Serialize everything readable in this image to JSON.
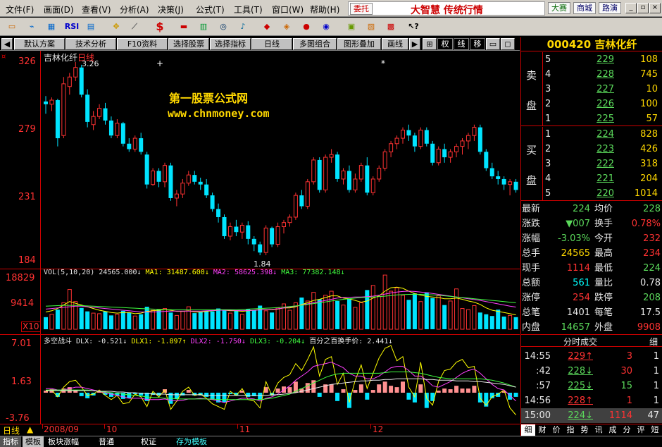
{
  "menu": [
    "文件(F)",
    "画面(D)",
    "查看(V)",
    "分析(A)",
    "决策(J)",
    "公式(T)",
    "工具(T)",
    "窗口(W)",
    "帮助(H)"
  ],
  "brand": {
    "order_btn": "委托",
    "logo": "大智慧 传统行情",
    "btn1": "大赛",
    "btn2": "商城",
    "btn3": "路演"
  },
  "toolbar": {
    "rsi": "RSI",
    "dollar": "$"
  },
  "tabs": [
    "默认方案",
    "技术分析",
    "F10资料",
    "选择股票",
    "选择指标",
    "日线",
    "多图组合",
    "图形叠加",
    "画线"
  ],
  "tabs_right": [
    "权",
    "线",
    "移"
  ],
  "chart": {
    "stock_label": "吉林化纤",
    "period_label": "日线",
    "price_ticks": [
      "326",
      "279",
      "231",
      "184"
    ],
    "high_mark": "3.26",
    "low_mark": "1.84",
    "watermark1": "第一股票公式网",
    "watermark2": "www.chnmoney.com",
    "vol_ticks": [
      "18829",
      "9414",
      "X10"
    ],
    "vol_legend": {
      "name": "VOL(5,10,20)",
      "val": "24565.000↓",
      "ma1": "MA1: 31487.600↓",
      "ma2": "MA2: 58625.398↓",
      "ma3": "MA3: 77382.148↓"
    },
    "ind_ticks": [
      "7.01",
      "1.63",
      "-3.76"
    ],
    "ind_legend": {
      "name": "多空战斗",
      "dlx": "DLX: -0.521↓",
      "dlx1": "DLX1: -1.897↑",
      "dlx2": "DLX2: -1.750↓",
      "dlx3": "DLX3: -0.204↓",
      "pct": "百分之百换手价: 2.441↓"
    },
    "date_labels": [
      "2008/09",
      "10",
      "11",
      "12"
    ],
    "candles": [
      [
        2.97,
        3.01,
        2.88,
        2.95
      ],
      [
        2.95,
        3.0,
        2.9,
        2.98
      ],
      [
        2.98,
        2.99,
        2.64,
        2.7
      ],
      [
        2.72,
        3.15,
        2.7,
        3.1
      ],
      [
        3.08,
        3.18,
        3.02,
        3.15
      ],
      [
        3.15,
        3.26,
        3.12,
        3.22
      ],
      [
        3.22,
        3.24,
        3.0,
        3.02
      ],
      [
        3.02,
        3.06,
        2.78,
        2.82
      ],
      [
        2.8,
        2.9,
        2.76,
        2.86
      ],
      [
        2.86,
        2.95,
        2.84,
        2.92
      ],
      [
        2.92,
        2.96,
        2.8,
        2.83
      ],
      [
        2.83,
        2.86,
        2.7,
        2.72
      ],
      [
        2.72,
        2.84,
        2.7,
        2.81
      ],
      [
        2.81,
        2.82,
        2.64,
        2.66
      ],
      [
        2.66,
        2.7,
        2.6,
        2.62
      ],
      [
        2.62,
        2.72,
        2.6,
        2.7
      ],
      [
        2.7,
        2.74,
        2.58,
        2.6
      ],
      [
        2.58,
        2.6,
        2.33,
        2.36
      ],
      [
        2.36,
        2.48,
        2.35,
        2.46
      ],
      [
        2.46,
        2.48,
        2.34,
        2.38
      ],
      [
        2.38,
        2.52,
        2.34,
        2.5
      ],
      [
        2.5,
        2.52,
        2.24,
        2.26
      ],
      [
        2.26,
        2.32,
        2.2,
        2.29
      ],
      [
        2.29,
        2.4,
        2.26,
        2.37
      ],
      [
        2.37,
        2.46,
        2.35,
        2.43
      ],
      [
        2.43,
        2.46,
        2.36,
        2.38
      ],
      [
        2.38,
        2.41,
        2.32,
        2.36
      ],
      [
        2.36,
        2.4,
        2.26,
        2.28
      ],
      [
        2.28,
        2.3,
        2.16,
        2.18
      ],
      [
        2.18,
        2.22,
        2.08,
        2.12
      ],
      [
        2.12,
        2.14,
        1.96,
        1.98
      ],
      [
        1.98,
        2.08,
        1.95,
        2.05
      ],
      [
        2.05,
        2.1,
        1.98,
        2.01
      ],
      [
        2.01,
        2.08,
        1.96,
        2.06
      ],
      [
        2.06,
        2.09,
        1.92,
        1.96
      ],
      [
        1.96,
        1.98,
        1.87,
        1.92
      ],
      [
        1.92,
        1.94,
        1.84,
        1.86
      ],
      [
        1.86,
        2.06,
        1.84,
        2.04
      ],
      [
        2.04,
        2.05,
        1.9,
        1.92
      ],
      [
        1.92,
        2.08,
        1.9,
        2.05
      ],
      [
        2.05,
        2.1,
        2.0,
        2.08
      ],
      [
        2.08,
        2.14,
        2.05,
        2.12
      ],
      [
        2.12,
        2.3,
        2.1,
        2.28
      ],
      [
        2.28,
        2.32,
        2.18,
        2.2
      ],
      [
        2.2,
        2.4,
        2.18,
        2.38
      ],
      [
        2.38,
        2.56,
        2.36,
        2.54
      ],
      [
        2.54,
        2.56,
        2.3,
        2.32
      ],
      [
        2.32,
        2.58,
        2.3,
        2.56
      ],
      [
        2.56,
        2.62,
        2.52,
        2.58
      ],
      [
        2.58,
        2.6,
        2.38,
        2.4
      ],
      [
        2.4,
        2.48,
        2.36,
        2.46
      ],
      [
        2.46,
        2.5,
        2.3,
        2.32
      ],
      [
        2.32,
        2.44,
        2.3,
        2.4
      ],
      [
        2.4,
        2.52,
        2.38,
        2.5
      ],
      [
        2.5,
        2.56,
        2.28,
        2.3
      ],
      [
        2.3,
        2.42,
        2.28,
        2.4
      ],
      [
        2.4,
        2.5,
        2.38,
        2.48
      ],
      [
        2.48,
        2.62,
        2.46,
        2.6
      ],
      [
        2.6,
        2.68,
        2.56,
        2.66
      ],
      [
        2.66,
        2.72,
        2.62,
        2.7
      ],
      [
        2.7,
        2.78,
        2.66,
        2.76
      ],
      [
        2.76,
        2.8,
        2.68,
        2.72
      ],
      [
        2.72,
        2.74,
        2.6,
        2.64
      ],
      [
        2.64,
        2.78,
        2.62,
        2.76
      ],
      [
        2.76,
        2.78,
        2.64,
        2.66
      ],
      [
        2.66,
        2.68,
        2.5,
        2.52
      ],
      [
        2.52,
        2.64,
        2.5,
        2.62
      ],
      [
        2.62,
        2.66,
        2.52,
        2.56
      ],
      [
        2.56,
        2.62,
        2.52,
        2.6
      ],
      [
        2.6,
        2.66,
        2.56,
        2.64
      ],
      [
        2.64,
        2.7,
        2.58,
        2.68
      ],
      [
        2.68,
        2.74,
        2.62,
        2.72
      ],
      [
        2.72,
        2.8,
        2.68,
        2.78
      ],
      [
        2.78,
        2.8,
        2.58,
        2.6
      ],
      [
        2.6,
        2.62,
        2.46,
        2.48
      ],
      [
        2.48,
        2.52,
        2.4,
        2.42
      ],
      [
        2.42,
        2.46,
        2.36,
        2.4
      ],
      [
        2.4,
        2.42,
        2.32,
        2.36
      ],
      [
        2.36,
        2.4,
        2.28,
        2.38
      ],
      [
        2.38,
        2.4,
        2.3,
        2.32
      ],
      [
        2.32,
        2.34,
        2.26,
        2.28
      ]
    ],
    "volumes": [
      4200,
      5200,
      6800,
      9200,
      13800,
      9600,
      7400,
      6200,
      5600,
      5400,
      6200,
      4800,
      5200,
      6400,
      5800,
      4600,
      5200,
      7800,
      6600,
      6800,
      7200,
      5800,
      4800,
      6200,
      7800,
      5600,
      6000,
      6400,
      6200,
      7200,
      6800,
      5600,
      6400,
      5200,
      7000,
      6600,
      8200,
      6400,
      5800,
      7400,
      8800,
      6600,
      9200,
      11000,
      9800,
      12800,
      10400,
      11800,
      13200,
      9800,
      8400,
      10600,
      7600,
      9200,
      13600,
      15200,
      11400,
      18800,
      13200,
      14400,
      11800,
      10200,
      12400,
      9600,
      12800,
      10800,
      11600,
      8400,
      9800,
      14000,
      7200,
      6800,
      8200,
      5800,
      5200,
      4600,
      6800,
      4400,
      4800,
      4200
    ],
    "ma_vol": {
      "ma1": [
        6000,
        6400,
        7200,
        8400,
        9600,
        9000,
        8400,
        7800,
        7200,
        6600,
        6200,
        5800,
        5600,
        5800,
        5800,
        5400,
        5600,
        6200,
        6400,
        6600,
        6800,
        6600,
        6200,
        6200,
        6400,
        6000,
        6000,
        6200,
        6400,
        6600,
        6600,
        6400,
        6400,
        6200,
        6400,
        6600,
        6800,
        6800,
        6800,
        7000,
        7400,
        7400,
        7800,
        8600,
        9200,
        10000,
        10400,
        11000,
        11600,
        11600,
        10800,
        10600,
        10000,
        9400,
        9800,
        10800,
        11600,
        13200,
        14400,
        14600,
        14200,
        13200,
        12400,
        11800,
        11400,
        11200,
        11000,
        10600,
        10600,
        10800,
        10400,
        9800,
        9400,
        8600,
        7400,
        6600,
        6200,
        5800,
        5400,
        5000
      ],
      "ma2": [
        7000,
        7200,
        7400,
        7600,
        7800,
        8000,
        8000,
        7800,
        7600,
        7400,
        7200,
        7000,
        6800,
        6600,
        6400,
        6200,
        6000,
        6000,
        6000,
        6100,
        6200,
        6300,
        6300,
        6300,
        6300,
        6300,
        6300,
        6400,
        6500,
        6600,
        6600,
        6600,
        6500,
        6500,
        6500,
        6600,
        6700,
        6800,
        6900,
        7100,
        7400,
        7700,
        8000,
        8400,
        8800,
        9200,
        9600,
        10000,
        10400,
        10800,
        11000,
        11100,
        11200,
        11200,
        11300,
        11500,
        11800,
        12200,
        12600,
        12900,
        13100,
        13200,
        13100,
        12900,
        12700,
        12400,
        12100,
        11800,
        11500,
        11200,
        10900,
        10600,
        10300,
        10000,
        9600,
        9200,
        8800,
        8400,
        8000,
        7700
      ],
      "ma3": [
        8000,
        8100,
        8200,
        8300,
        8300,
        8300,
        8200,
        8100,
        8000,
        7900,
        7800,
        7700,
        7600,
        7500,
        7400,
        7300,
        7200,
        7100,
        7000,
        6900,
        6800,
        6800,
        6800,
        6800,
        6800,
        6800,
        6800,
        6800,
        6800,
        6800,
        6800,
        6800,
        6800,
        6900,
        7000,
        7100,
        7200,
        7300,
        7400,
        7500,
        7700,
        7900,
        8100,
        8300,
        8600,
        8900,
        9200,
        9500,
        9800,
        10100,
        10400,
        10600,
        10800,
        11000,
        11100,
        11200,
        11300,
        11500,
        11700,
        11900,
        12000,
        12100,
        12100,
        12100,
        12000,
        11900,
        11800,
        11600,
        11400,
        11200,
        11000,
        10800,
        10600,
        10400,
        10200,
        10000,
        9800,
        9600,
        9400,
        9200
      ]
    },
    "indicator": {
      "bars": [
        0.3,
        0.5,
        -0.6,
        0.6,
        0.8,
        0.4,
        -0.5,
        -0.8,
        -0.4,
        0.2,
        -0.3,
        -0.6,
        -0.4,
        -0.9,
        -0.8,
        -0.2,
        -0.4,
        -1.2,
        -0.3,
        -0.4,
        0.5,
        -1.6,
        -0.9,
        -0.4,
        0.4,
        -0.4,
        -0.4,
        -0.6,
        -1.0,
        -1.4,
        -1.4,
        -0.2,
        -0.4,
        0.3,
        -0.6,
        -0.5,
        -1.0,
        0.8,
        -0.4,
        0.6,
        0.9,
        0.8,
        1.6,
        0.6,
        1.4,
        1.8,
        -0.6,
        1.2,
        1.2,
        -1.2,
        0.5,
        -2.2,
        0.4,
        1.2,
        -1.0,
        0.4,
        1.2,
        1.6,
        1.0,
        0.8,
        1.6,
        -1.0,
        -1.4,
        1.2,
        -2.2,
        -1.2,
        0.3,
        0.6,
        0.5,
        1.0,
        0.6,
        0.6,
        1.0,
        -1.4,
        -2.0,
        -0.8,
        -0.6,
        0.2,
        -1.0,
        -0.6
      ],
      "dlx": [
        0.2,
        0.4,
        -0.6,
        0.8,
        1.6,
        1.8,
        0.8,
        -0.4,
        -0.2,
        0.4,
        -0.4,
        -1.0,
        -0.4,
        -1.6,
        -1.4,
        -0.2,
        -0.6,
        -2.0,
        0.2,
        -0.6,
        0.4,
        -2.4,
        -1.2,
        0.2,
        0.8,
        -0.4,
        -0.2,
        -0.8,
        -1.6,
        -2.0,
        -2.4,
        0.2,
        -0.4,
        0.6,
        -1.0,
        -1.2,
        -2.2,
        1.6,
        -0.4,
        1.4,
        2.2,
        2.6,
        4.2,
        3.2,
        4.8,
        6.6,
        2.4,
        4.8,
        5.2,
        1.2,
        2.8,
        -1.4,
        1.8,
        4.0,
        0.6,
        2.8,
        5.0,
        6.4,
        6.8,
        4.6,
        5.2,
        0.8,
        -0.6,
        4.4,
        -0.8,
        -1.8,
        1.6,
        3.2,
        3.4,
        4.4,
        4.8,
        3.6,
        3.8,
        -0.8,
        -1.8,
        -0.6,
        -0.2,
        0.4,
        -2.2,
        -3.2
      ],
      "dlx1": [
        0.6,
        0.6,
        0.4,
        0.4,
        0.6,
        0.8,
        0.8,
        0.6,
        0.4,
        0.2,
        0.0,
        -0.2,
        -0.4,
        -0.6,
        -0.8,
        -0.8,
        -0.8,
        -1.0,
        -1.0,
        -1.0,
        -0.9,
        -1.1,
        -1.2,
        -1.1,
        -0.9,
        -0.9,
        -0.8,
        -0.9,
        -1.0,
        -1.2,
        -1.4,
        -1.2,
        -1.0,
        -0.8,
        -0.8,
        -0.9,
        -1.2,
        -0.8,
        -0.6,
        -0.2,
        0.4,
        1.0,
        1.8,
        2.4,
        3.0,
        3.8,
        4.0,
        4.2,
        4.4,
        4.0,
        3.6,
        2.8,
        2.4,
        2.4,
        2.0,
        2.0,
        2.4,
        3.0,
        3.6,
        3.8,
        3.8,
        3.2,
        2.4,
        2.4,
        1.8,
        1.0,
        0.8,
        1.2,
        1.6,
        2.2,
        2.8,
        3.2,
        3.4,
        2.8,
        2.0,
        1.2,
        0.6,
        0.4,
        -0.4,
        -1.2
      ],
      "dlx2": [
        0.4,
        0.4,
        0.4,
        0.4,
        0.4,
        0.4,
        0.4,
        0.4,
        0.3,
        0.2,
        0.1,
        0.0,
        -0.1,
        -0.2,
        -0.3,
        -0.4,
        -0.5,
        -0.6,
        -0.7,
        -0.7,
        -0.8,
        -0.8,
        -0.9,
        -0.9,
        -0.9,
        -0.9,
        -0.9,
        -0.9,
        -0.9,
        -1.0,
        -1.0,
        -1.0,
        -1.0,
        -1.0,
        -1.0,
        -1.0,
        -1.0,
        -0.9,
        -0.8,
        -0.6,
        -0.4,
        -0.2,
        0.2,
        0.6,
        1.0,
        1.4,
        1.8,
        2.2,
        2.5,
        2.7,
        2.8,
        2.8,
        2.8,
        2.8,
        2.8,
        2.8,
        2.8,
        2.9,
        3.0,
        3.0,
        3.0,
        3.0,
        2.9,
        2.8,
        2.6,
        2.4,
        2.2,
        2.1,
        2.0,
        2.0,
        2.0,
        2.0,
        2.0,
        2.0,
        1.9,
        1.8,
        1.6,
        1.4,
        1.1,
        0.8
      ],
      "dlx3": [
        0.3,
        0.3,
        0.3,
        0.3,
        0.3,
        0.3,
        0.3,
        0.3,
        0.3,
        0.2,
        0.2,
        0.2,
        0.1,
        0.1,
        0.0,
        0.0,
        -0.1,
        -0.1,
        -0.2,
        -0.2,
        -0.2,
        -0.3,
        -0.3,
        -0.3,
        -0.3,
        -0.3,
        -0.3,
        -0.4,
        -0.4,
        -0.4,
        -0.4,
        -0.4,
        -0.4,
        -0.4,
        -0.4,
        -0.4,
        -0.4,
        -0.4,
        -0.3,
        -0.3,
        -0.2,
        -0.1,
        0.0,
        0.2,
        0.4,
        0.6,
        0.8,
        1.0,
        1.2,
        1.3,
        1.4,
        1.5,
        1.6,
        1.7,
        1.7,
        1.8,
        1.8,
        1.9,
        1.9,
        2.0,
        2.0,
        2.0,
        2.0,
        2.0,
        1.9,
        1.9,
        1.8,
        1.8,
        1.8,
        1.7,
        1.7,
        1.7,
        1.6,
        1.6,
        1.5,
        1.4,
        1.3,
        1.2,
        1.0,
        0.8
      ]
    }
  },
  "right_panel": {
    "title": "000420 吉林化纤",
    "sell_label_top": "卖",
    "sell_label_bottom": "盘",
    "buy_label_top": "买",
    "buy_label_bottom": "盘",
    "sell": [
      [
        "5",
        "229",
        "108"
      ],
      [
        "4",
        "228",
        "745"
      ],
      [
        "3",
        "227",
        "10"
      ],
      [
        "2",
        "226",
        "100"
      ],
      [
        "1",
        "225",
        "57"
      ]
    ],
    "buy": [
      [
        "1",
        "224",
        "828"
      ],
      [
        "2",
        "223",
        "426"
      ],
      [
        "3",
        "222",
        "318"
      ],
      [
        "4",
        "221",
        "204"
      ],
      [
        "5",
        "220",
        "1014"
      ]
    ],
    "stats": [
      [
        "最新",
        "224",
        "均价",
        "228"
      ],
      [
        "涨跌",
        "▼007",
        "换手",
        "0.78%"
      ],
      [
        "涨幅",
        "-3.03%",
        "今开",
        "232"
      ],
      [
        "总手",
        "24565",
        "最高",
        "234"
      ],
      [
        "现手",
        "1114",
        "最低",
        "224"
      ],
      [
        "总额",
        "561",
        "量比",
        "0.78"
      ],
      [
        "涨停",
        "254",
        "跌停",
        "208"
      ],
      [
        "总笔",
        "1401",
        "每笔",
        "17.5"
      ],
      [
        "内盘",
        "14657",
        "外盘",
        "9908"
      ]
    ],
    "ticks_title": "分时成交",
    "ticks_detail": "细",
    "ticks": [
      [
        "14:55",
        "229↑",
        "3",
        "1"
      ],
      [
        ":42",
        "228↓",
        "30",
        "1"
      ],
      [
        ":57",
        "225↓",
        "15",
        "1"
      ],
      [
        "14:56",
        "228↑",
        "1",
        "1"
      ],
      [
        "15:00",
        "224↓",
        "1114",
        "47"
      ]
    ],
    "bottom_tabs": [
      "细",
      "财",
      "价",
      "指",
      "势",
      "讯",
      "成",
      "分",
      "评",
      "短"
    ]
  },
  "statusbar": {
    "period": "日线",
    "tabs": [
      "指标",
      "模板",
      "板块涨幅",
      "普通",
      "权证",
      "存为模板"
    ]
  }
}
